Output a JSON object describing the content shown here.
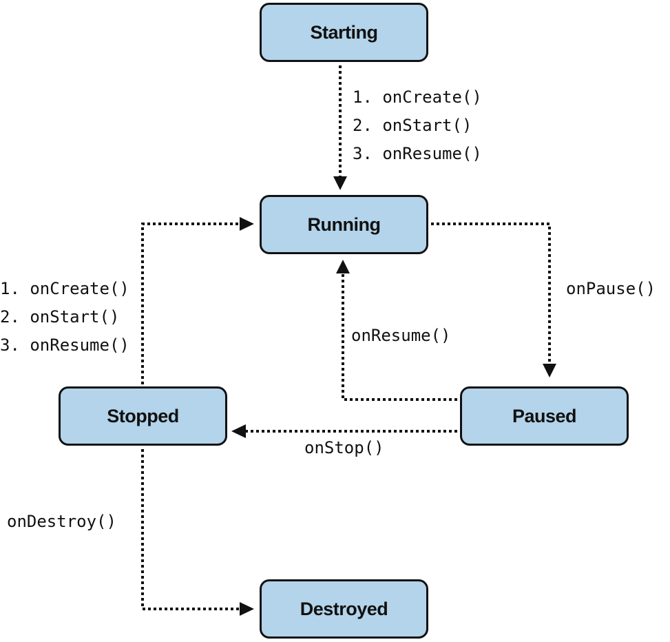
{
  "states": {
    "starting": "Starting",
    "running": "Running",
    "paused": "Paused",
    "stopped": "Stopped",
    "destroyed": "Destroyed"
  },
  "transitions": {
    "starting_to_running": [
      "1. onCreate()",
      "2. onStart()",
      "3. onResume()"
    ],
    "stopped_to_running": [
      "1. onCreate()",
      "2. onStart()",
      "3. onResume()"
    ],
    "running_to_paused": "onPause()",
    "paused_to_running": "onResume()",
    "paused_to_stopped": "onStop()",
    "stopped_to_destroyed": "onDestroy()"
  },
  "colors": {
    "state_fill": "#b3d4ea",
    "stroke": "#111111"
  }
}
